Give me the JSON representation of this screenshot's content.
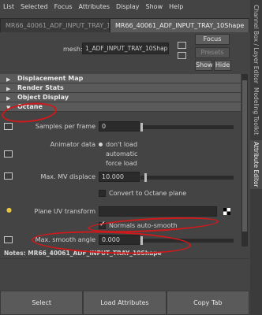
{
  "menu": [
    "List",
    "Selected",
    "Focus",
    "Attributes",
    "Display",
    "Show",
    "Help"
  ],
  "tabs": [
    {
      "label": "MR66_40061_ADF_INPUT_TRAY_10",
      "active": false
    },
    {
      "label": "MR66_40061_ADF_INPUT_TRAY_10Shape",
      "active": true
    }
  ],
  "header": {
    "mesh_label": "mesh:",
    "mesh_value": "1_ADF_INPUT_TRAY_10Shape",
    "focus_label": "Focus",
    "presets_label": "Presets",
    "show_label": "Show",
    "hide_label": "Hide"
  },
  "sections": [
    {
      "label": "Displacement Map",
      "expanded": false
    },
    {
      "label": "Render Stats",
      "expanded": false
    },
    {
      "label": "Object Display",
      "expanded": false
    },
    {
      "label": "Octane",
      "expanded": true
    }
  ],
  "octane": {
    "samples_label": "Samples per frame",
    "samples_value": "0",
    "animator_label": "Animator data",
    "animator_options": [
      "don't load",
      "automatic",
      "force load"
    ],
    "animator_selected": "don't load",
    "max_mv_label": "Max. MV displace",
    "max_mv_value": "10.000",
    "convert_label": "Convert to Octane plane",
    "plane_uv_label": "Plane UV transform",
    "normals_label": "Normals auto-smooth",
    "max_smooth_label": "Max. smooth angle",
    "max_smooth_value": "0.000"
  },
  "notes": {
    "label": "Notes:",
    "value": "MR66_40061_ADF_INPUT_TRAY_10Shape"
  },
  "bottom": {
    "select_label": "Select",
    "load_label": "Load Attributes",
    "copy_label": "Copy Tab"
  },
  "side_tabs": [
    "Channel Box / Layer Editor",
    "Modeling Toolkit",
    "Attribute Editor"
  ],
  "colors": {
    "annotation": "#d0191b",
    "background": "#444444"
  }
}
